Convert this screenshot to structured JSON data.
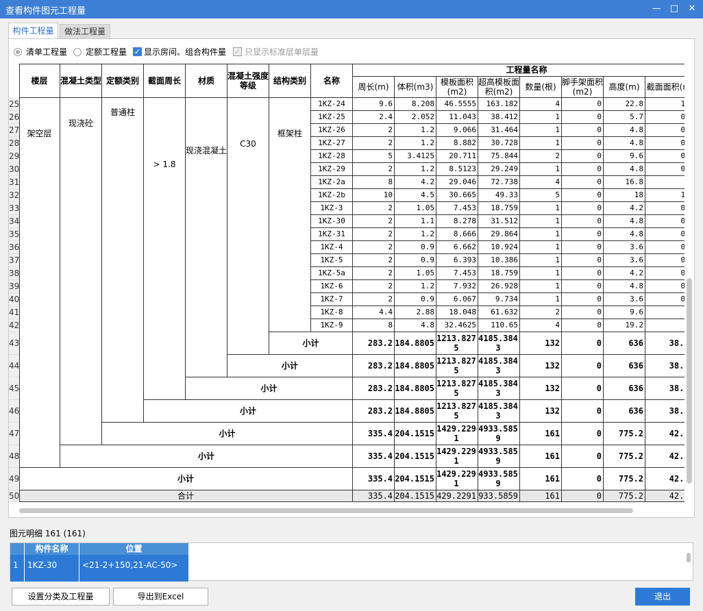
{
  "window": {
    "title": "查看构件图元工程量",
    "min": "—",
    "max": "□",
    "close": "✕"
  },
  "tabs": [
    "构件工程量",
    "做法工程量"
  ],
  "options": {
    "r1": "清单工程量",
    "r2": "定额工程量",
    "c1": "显示房间、组合构件量",
    "c2": "只显示标准层单层量",
    "check": "✓"
  },
  "header": {
    "floor": "楼层",
    "ctype": "混凝土类型",
    "qtype": "定额类别",
    "perim": "截面周长",
    "mat": "材质",
    "grade": "混凝土强度等级",
    "stype": "结构类别",
    "name": "名称",
    "group": "工程量名称",
    "cols": [
      "周长(m)",
      "体积(m3)",
      "模板面积(m2)",
      "超高模板面积(m2)",
      "数量(根)",
      "脚手架面积(m2)",
      "高度(m)",
      "截面面积(m2)"
    ]
  },
  "merged": {
    "floor": "架空层",
    "ctype": "现浇砼",
    "qtype": "普通柱",
    "perim": "> 1.8",
    "mat": "现浇混凝土",
    "grade": "C30",
    "stype": "框架柱"
  },
  "rows": [
    {
      "n": "25",
      "name": "1KZ-24",
      "v": [
        "9.6",
        "8.208",
        "46.5555",
        "163.182",
        "4",
        "0",
        "22.8",
        "1.44"
      ]
    },
    {
      "n": "26",
      "name": "1KZ-25",
      "v": [
        "2.4",
        "2.052",
        "11.043",
        "38.412",
        "1",
        "0",
        "5.7",
        "0.36"
      ]
    },
    {
      "n": "27",
      "name": "1KZ-26",
      "v": [
        "2",
        "1.2",
        "9.066",
        "31.464",
        "1",
        "0",
        "4.8",
        "0.25"
      ]
    },
    {
      "n": "28",
      "name": "1KZ-27",
      "v": [
        "2",
        "1.2",
        "8.882",
        "30.728",
        "1",
        "0",
        "4.8",
        "0.25"
      ]
    },
    {
      "n": "29",
      "name": "1KZ-28",
      "v": [
        "5",
        "3.4125",
        "20.711",
        "75.844",
        "2",
        "0",
        "9.6",
        "0.75"
      ]
    },
    {
      "n": "30",
      "name": "1KZ-29",
      "v": [
        "2",
        "1.2",
        "8.5123",
        "29.249",
        "1",
        "0",
        "4.8",
        "0.25"
      ]
    },
    {
      "n": "31",
      "name": "1KZ-2a",
      "v": [
        "8",
        "4.2",
        "29.046",
        "72.738",
        "4",
        "0",
        "16.8",
        "1"
      ]
    },
    {
      "n": "32",
      "name": "1KZ-2b",
      "v": [
        "10",
        "4.5",
        "30.665",
        "49.33",
        "5",
        "0",
        "18",
        "1.25"
      ]
    },
    {
      "n": "33",
      "name": "1KZ-3",
      "v": [
        "2",
        "1.05",
        "7.453",
        "18.759",
        "1",
        "0",
        "4.2",
        "0.25"
      ]
    },
    {
      "n": "34",
      "name": "1KZ-30",
      "v": [
        "2",
        "1.1",
        "8.278",
        "31.512",
        "1",
        "0",
        "4.8",
        "0.25"
      ]
    },
    {
      "n": "35",
      "name": "1KZ-31",
      "v": [
        "2",
        "1.2",
        "8.666",
        "29.864",
        "1",
        "0",
        "4.8",
        "0.25"
      ]
    },
    {
      "n": "36",
      "name": "1KZ-4",
      "v": [
        "2",
        "0.9",
        "6.662",
        "10.924",
        "1",
        "0",
        "3.6",
        "0.25"
      ]
    },
    {
      "n": "37",
      "name": "1KZ-5",
      "v": [
        "2",
        "0.9",
        "6.393",
        "10.386",
        "1",
        "0",
        "3.6",
        "0.25"
      ]
    },
    {
      "n": "38",
      "name": "1KZ-5a",
      "v": [
        "2",
        "1.05",
        "7.453",
        "18.759",
        "1",
        "0",
        "4.2",
        "0.25"
      ]
    },
    {
      "n": "39",
      "name": "1KZ-6",
      "v": [
        "2",
        "1.2",
        "7.932",
        "26.928",
        "1",
        "0",
        "4.8",
        "0.25"
      ]
    },
    {
      "n": "40",
      "name": "1KZ-7",
      "v": [
        "2",
        "0.9",
        "6.067",
        "9.734",
        "1",
        "0",
        "3.6",
        "0.25"
      ]
    },
    {
      "n": "41",
      "name": "1KZ-8",
      "v": [
        "4.4",
        "2.88",
        "18.048",
        "61.632",
        "2",
        "0",
        "9.6",
        "0.6"
      ]
    },
    {
      "n": "42",
      "name": "1KZ-9",
      "v": [
        "8",
        "4.8",
        "32.4625",
        "110.65",
        "4",
        "0",
        "19.2",
        "1"
      ]
    }
  ],
  "subtotal_label": "小计",
  "subtotals": [
    {
      "n": "43",
      "v": [
        "283.2",
        "184.8805",
        "1213.8275",
        "4185.3843",
        "132",
        "0",
        "636",
        "38.285"
      ]
    },
    {
      "n": "44",
      "v": [
        "283.2",
        "184.8805",
        "1213.8275",
        "4185.3843",
        "132",
        "0",
        "636",
        "38.285"
      ]
    },
    {
      "n": "45",
      "v": [
        "283.2",
        "184.8805",
        "1213.8275",
        "4185.3843",
        "132",
        "0",
        "636",
        "38.285"
      ]
    },
    {
      "n": "46",
      "v": [
        "283.2",
        "184.8805",
        "1213.8275",
        "4185.3843",
        "132",
        "0",
        "636",
        "38.285"
      ]
    },
    {
      "n": "47",
      "v": [
        "335.4",
        "204.1515",
        "1429.2291",
        "4933.5859",
        "161",
        "0",
        "775.2",
        "42.345"
      ]
    },
    {
      "n": "48",
      "v": [
        "335.4",
        "204.1515",
        "1429.2291",
        "4933.5859",
        "161",
        "0",
        "775.2",
        "42.345"
      ]
    },
    {
      "n": "49",
      "v": [
        "335.4",
        "204.1515",
        "1429.2291",
        "4933.5859",
        "161",
        "0",
        "775.2",
        "42.345"
      ]
    }
  ],
  "total": {
    "n": "50",
    "label": "合计",
    "v": [
      "335.4",
      "204.1515",
      "1429.2291",
      "4933.5859",
      "161",
      "0",
      "775.2",
      "42.345"
    ]
  },
  "detail": {
    "label": "图元明细  161 (161)",
    "h1": "构件名称",
    "h2": "位置",
    "row": "1",
    "name": "1KZ-30",
    "pos": "<21-2+150,21-AC-50>"
  },
  "buttons": {
    "b1": "设置分类及工程量",
    "b2": "导出到Excel",
    "b3": "退出"
  },
  "colors": {
    "accent": "#3c7fd4",
    "selected": "#2d7ad6"
  }
}
